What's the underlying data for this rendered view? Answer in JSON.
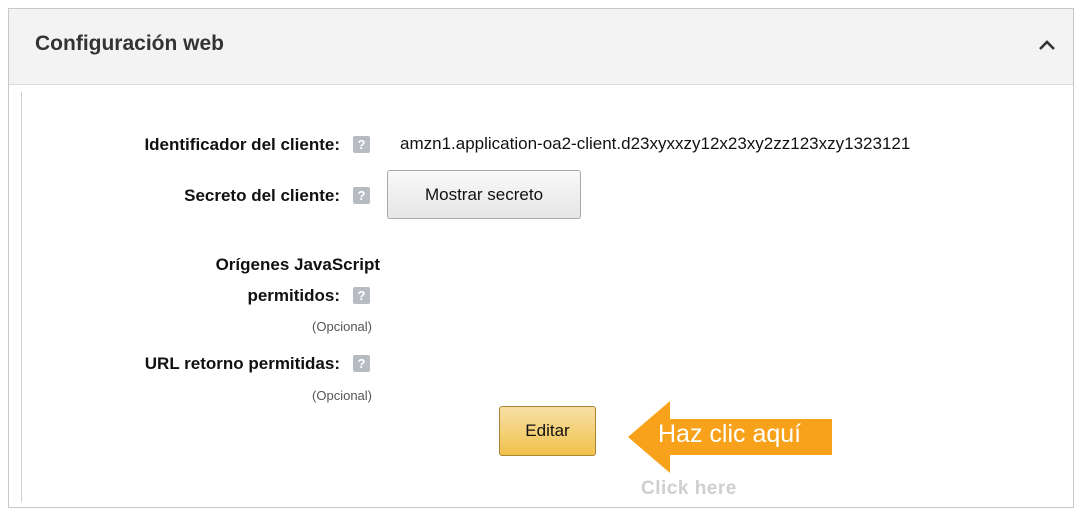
{
  "panel": {
    "title": "Configuración web",
    "collapse_icon": "chevron-up-icon"
  },
  "fields": {
    "client_id": {
      "label": "Identificador del cliente:",
      "value": "amzn1.application-oa2-client.d23xyxxzy12x23xy2zz123xzy1323121"
    },
    "client_secret": {
      "label": "Secreto del cliente:",
      "button_label": "Mostrar secreto"
    },
    "js_origins": {
      "label_line1": "Orígenes JavaScript",
      "label_line2": "permitidos:",
      "optional": "(Opcional)"
    },
    "return_urls": {
      "label": "URL retorno permitidas:",
      "optional": "(Opcional)"
    },
    "help_icon_glyph": "?"
  },
  "edit_button_label": "Editar",
  "callout": {
    "text": "Haz clic aquí",
    "color": "#f7a21a"
  },
  "ghost_text": "Click here"
}
